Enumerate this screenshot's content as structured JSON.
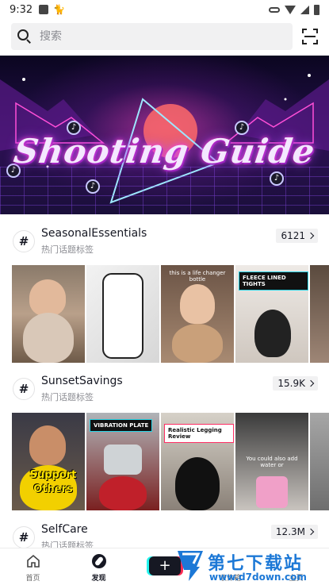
{
  "status_bar": {
    "time": "9:32"
  },
  "search": {
    "placeholder": "搜索"
  },
  "banner": {
    "title": "Shooting Guide"
  },
  "hashtags": [
    {
      "name": "SeasonalEssentials",
      "subtitle": "热门话题标签",
      "count": "6121",
      "thumbs": [
        {
          "caption": "",
          "label": ""
        },
        {
          "caption": "",
          "label": ""
        },
        {
          "caption": "this is a life changer bottle",
          "label": ""
        },
        {
          "caption": "",
          "label": "FLEECE LINED TIGHTS"
        },
        {
          "caption": "",
          "label": ""
        }
      ]
    },
    {
      "name": "SunsetSavings",
      "subtitle": "热门话题标签",
      "count": "15.9K",
      "thumbs": [
        {
          "caption": "",
          "label": "Support Others"
        },
        {
          "caption": "",
          "label": "VIBRATION PLATE"
        },
        {
          "caption": "",
          "label": "Realistic Legging Review"
        },
        {
          "caption": "You could also add water or",
          "label": ""
        },
        {
          "caption": "",
          "label": ""
        }
      ]
    },
    {
      "name": "SelfCare",
      "subtitle": "热门话题标签",
      "count": "12.3M"
    }
  ],
  "bottom_nav": {
    "home": "首页",
    "discover": "发现",
    "create": "+",
    "inbox": "收件箱",
    "profile": "主页"
  },
  "watermark": {
    "title": "第七下载站",
    "url": "www.d7down.com"
  },
  "colors": {
    "accent_cyan": "#25f4ee",
    "accent_red": "#fe2c55",
    "text_primary": "#161823",
    "text_secondary": "#8a8b91"
  }
}
